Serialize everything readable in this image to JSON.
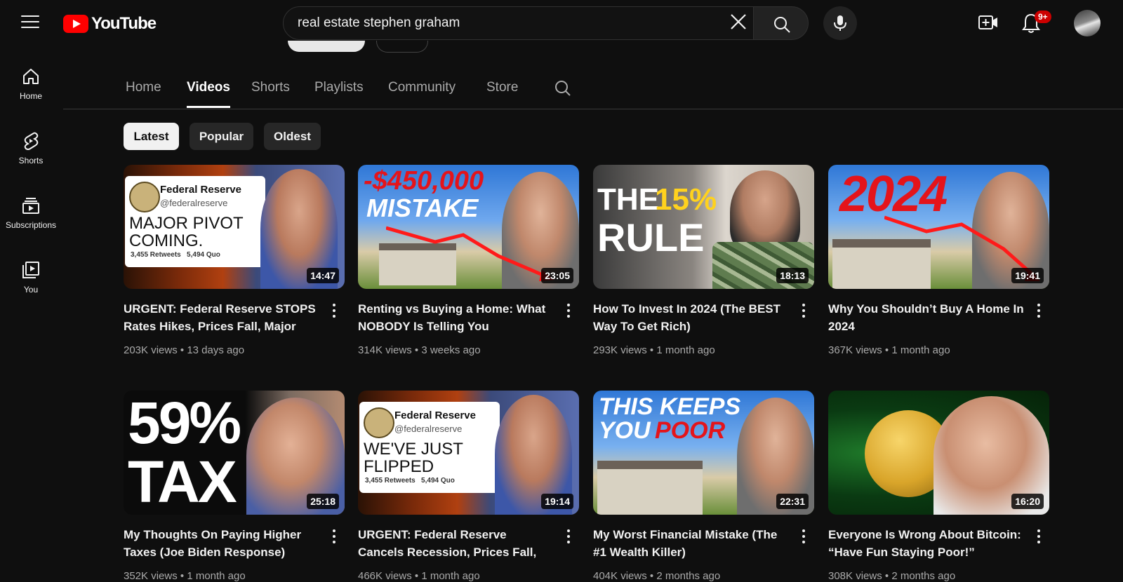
{
  "header": {
    "logo_text": "YouTube",
    "search": {
      "value": "real estate stephen graham",
      "placeholder": "Search"
    },
    "notification_count": "9+"
  },
  "sidebar": {
    "items": [
      {
        "label": "Home",
        "icon": "home-icon"
      },
      {
        "label": "Shorts",
        "icon": "shorts-icon"
      },
      {
        "label": "Subscriptions",
        "icon": "subscriptions-icon"
      },
      {
        "label": "You",
        "icon": "library-icon"
      }
    ]
  },
  "channel_tabs": {
    "items": [
      "Home",
      "Videos",
      "Shorts",
      "Playlists",
      "Community",
      "Store"
    ],
    "active": "Videos"
  },
  "filters": {
    "items": [
      "Latest",
      "Popular",
      "Oldest"
    ],
    "active": "Latest"
  },
  "videos": [
    {
      "title": "URGENT: Federal Reserve STOPS Rates Hikes, Prices Fall, Major Piv…",
      "views": "203K views",
      "age": "13 days ago",
      "duration": "14:47",
      "thumb": {
        "lines": [
          "Federal Reserve",
          "@federalreserve",
          "MAJOR PIVOT",
          "COMING.",
          "3,455 Retweets   5,494 Quo"
        ]
      }
    },
    {
      "title": "Renting vs Buying a Home: What NOBODY Is Telling You",
      "views": "314K views",
      "age": "3 weeks ago",
      "duration": "23:05",
      "thumb": {
        "lines": [
          "-$450,000",
          "MISTAKE"
        ]
      }
    },
    {
      "title": "How To Invest In 2024 (The BEST Way To Get Rich)",
      "views": "293K views",
      "age": "1 month ago",
      "duration": "18:13",
      "thumb": {
        "lines": [
          "THE",
          "15%",
          "RULE"
        ]
      }
    },
    {
      "title": "Why You Shouldn’t Buy A Home In 2024",
      "views": "367K views",
      "age": "1 month ago",
      "duration": "19:41",
      "thumb": {
        "lines": [
          "2024"
        ]
      }
    },
    {
      "title": "My Thoughts On Paying Higher Taxes (Joe Biden Response)",
      "views": "352K views",
      "age": "1 month ago",
      "duration": "25:18",
      "thumb": {
        "lines": [
          "59%",
          "TAX"
        ]
      }
    },
    {
      "title": "URGENT: Federal Reserve Cancels Recession, Prices Fall, Massive…",
      "views": "466K views",
      "age": "1 month ago",
      "duration": "19:14",
      "thumb": {
        "lines": [
          "Federal Reserve",
          "@federalreserve",
          "WE'VE JUST",
          "FLIPPED",
          "3,455 Retweets   5,494 Quo"
        ]
      }
    },
    {
      "title": "My Worst Financial Mistake (The #1 Wealth Killer)",
      "views": "404K views",
      "age": "2 months ago",
      "duration": "22:31",
      "thumb": {
        "lines": [
          "THIS KEEPS",
          "YOU",
          "POOR"
        ]
      }
    },
    {
      "title": "Everyone Is Wrong About Bitcoin: “Have Fun Staying Poor!”",
      "views": "308K views",
      "age": "2 months ago",
      "duration": "16:20",
      "thumb": {
        "lines": []
      }
    }
  ],
  "colors": {
    "accent_red": "#ff0000",
    "bg": "#0f0f0f",
    "thumb_red": "#e4141b",
    "thumb_yellow": "#ffd21e"
  }
}
